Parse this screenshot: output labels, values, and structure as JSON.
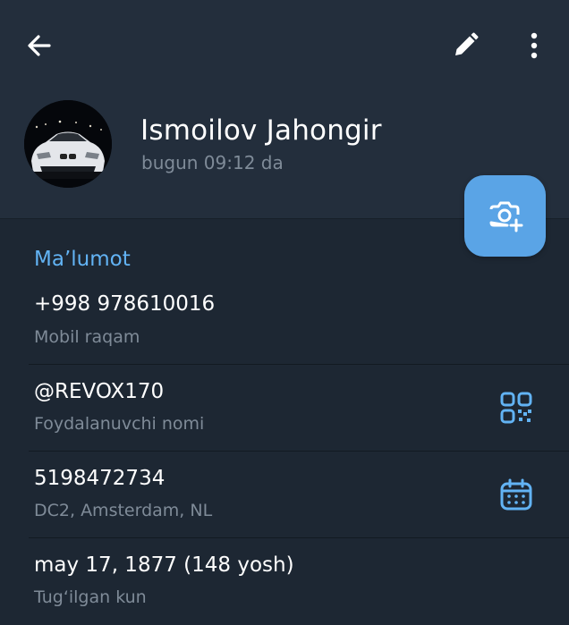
{
  "contact": {
    "name": "Ismoilov Jahongir",
    "last_seen": "bugun 09:12 da"
  },
  "info": {
    "section_title": "Ma’lumot",
    "rows": [
      {
        "value": "+998 978610016",
        "label": "Mobil raqam"
      },
      {
        "value": "@REVOX170",
        "label": "Foydalanuvchi nomi",
        "icon": "qr-code-icon"
      },
      {
        "value": "5198472734",
        "label": "DC2, Amsterdam, NL",
        "icon": "calendar-icon"
      },
      {
        "value": "may 17, 1877 (148 yosh)",
        "label": "Tug‘ilgan kun"
      }
    ]
  },
  "icons": {
    "back": "arrow-left-icon",
    "edit": "pencil-icon",
    "menu": "more-vertical-icon",
    "set_photo": "camera-add-icon"
  },
  "colors": {
    "background": "#1d2733",
    "header": "#232e3c",
    "accent": "#62b3f4",
    "fab": "#5aa4e6",
    "secondary_text": "#7f8b98"
  }
}
